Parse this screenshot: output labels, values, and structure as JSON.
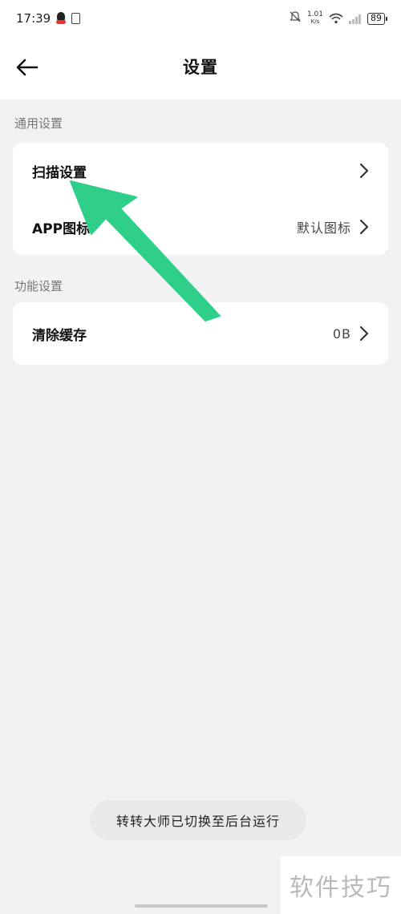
{
  "status_bar": {
    "time": "17:39",
    "net_speed_value": "1.01",
    "net_speed_unit": "K/s",
    "battery": "89"
  },
  "header": {
    "title": "设置"
  },
  "sections": [
    {
      "label": "通用设置",
      "rows": [
        {
          "label": "扫描设置",
          "value": ""
        },
        {
          "label": "APP图标",
          "value": "默认图标"
        }
      ]
    },
    {
      "label": "功能设置",
      "rows": [
        {
          "label": "清除缓存",
          "value": "0B"
        }
      ]
    }
  ],
  "toast": "转转大师已切换至后台运行",
  "watermark": "软件技巧",
  "colors": {
    "background": "#f2f2f4",
    "card": "#ffffff",
    "annotation_arrow": "#2fcf8a"
  },
  "icons": [
    "back-arrow-icon",
    "chevron-right-icon",
    "mute-icon",
    "wifi-icon",
    "signal-icon",
    "battery-icon",
    "qq-icon"
  ]
}
